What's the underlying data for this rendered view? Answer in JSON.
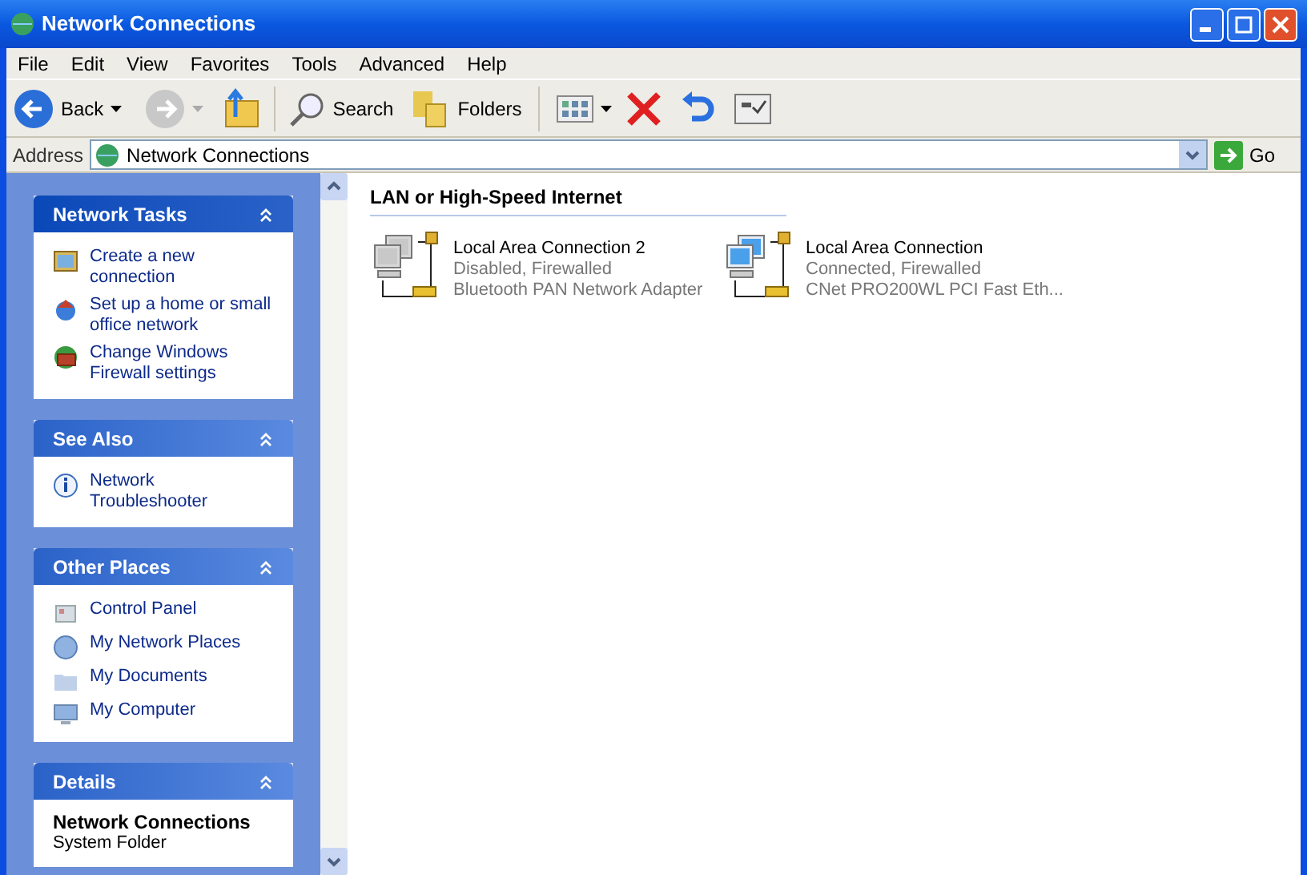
{
  "window": {
    "title": "Network Connections"
  },
  "menu": [
    "File",
    "Edit",
    "View",
    "Favorites",
    "Tools",
    "Advanced",
    "Help"
  ],
  "toolbar": {
    "back": "Back",
    "search": "Search",
    "folders": "Folders",
    "forward_disabled": true
  },
  "address": {
    "label": "Address",
    "value": "Network Connections",
    "go": "Go"
  },
  "panels": [
    {
      "title": "Network Tasks",
      "kind": "links",
      "items": [
        {
          "text": "Create a new connection"
        },
        {
          "text": "Set up a home or small office network"
        },
        {
          "text": "Change Windows Firewall settings"
        }
      ]
    },
    {
      "title": "See Also",
      "kind": "links",
      "items": [
        {
          "text": "Network Troubleshooter"
        }
      ]
    },
    {
      "title": "Other Places",
      "kind": "links",
      "items": [
        {
          "text": "Control Panel"
        },
        {
          "text": "My Network Places"
        },
        {
          "text": "My Documents"
        },
        {
          "text": "My Computer"
        }
      ]
    },
    {
      "title": "Details",
      "kind": "details",
      "name": "Network Connections",
      "subtitle": "System Folder"
    }
  ],
  "group": {
    "title": "LAN or High-Speed Internet",
    "connections": [
      {
        "name": "Local Area Connection 2",
        "status": "Disabled, Firewalled",
        "adapter": "Bluetooth PAN Network Adapter",
        "connected": false
      },
      {
        "name": "Local Area Connection",
        "status": "Connected, Firewalled",
        "adapter": "CNet PRO200WL PCI Fast Eth...",
        "connected": true
      }
    ]
  }
}
